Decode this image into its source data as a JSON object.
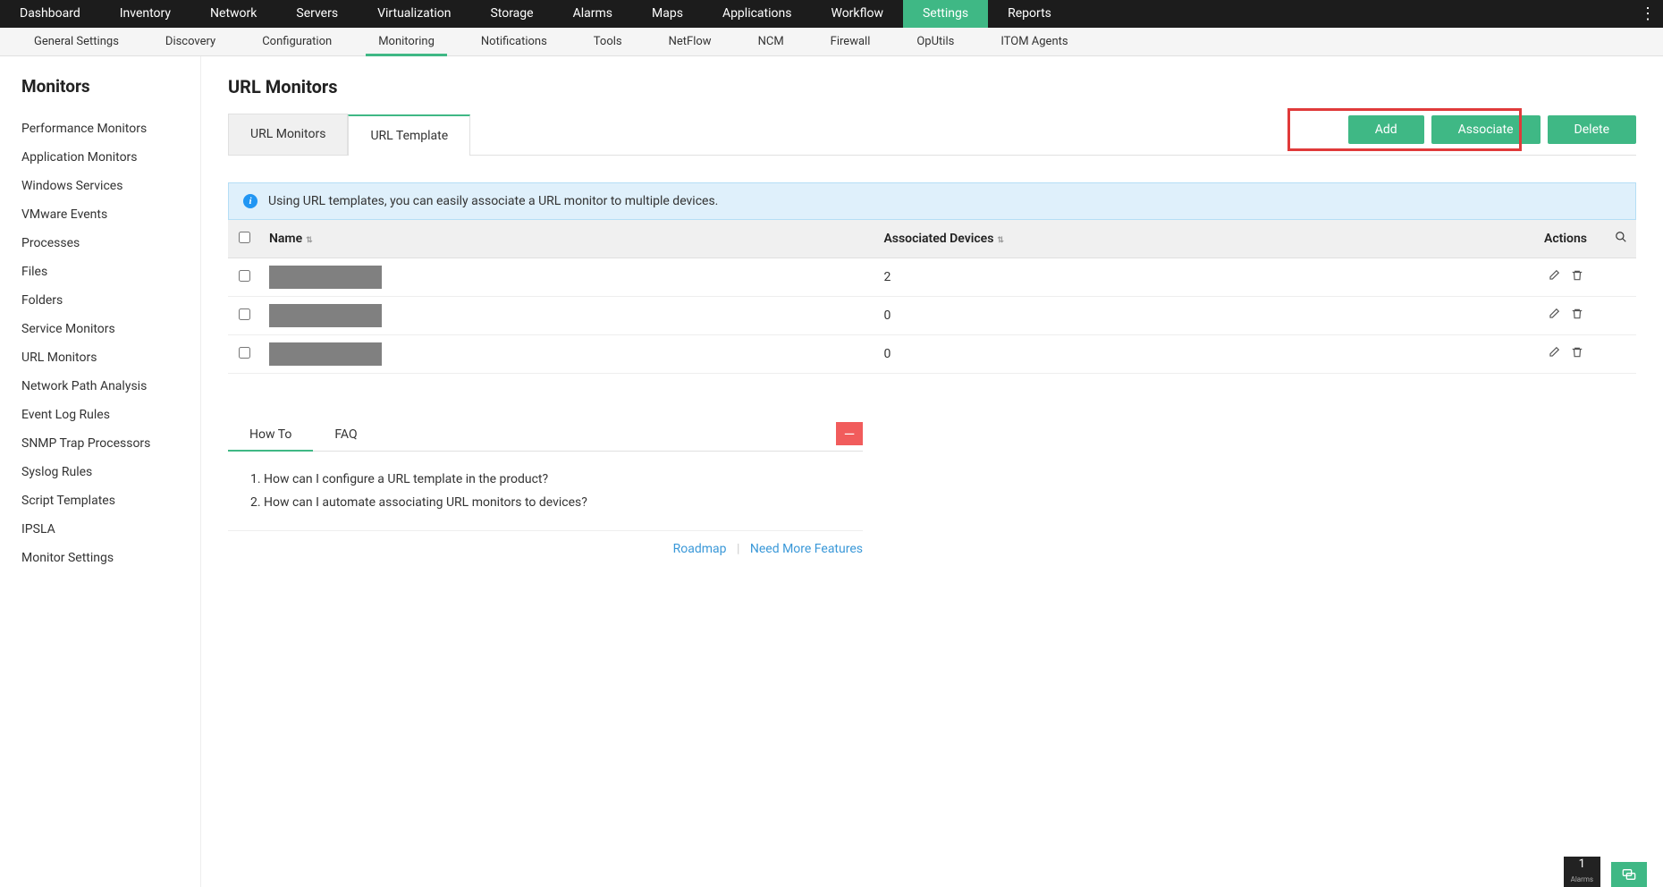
{
  "topnav": {
    "items": [
      "Dashboard",
      "Inventory",
      "Network",
      "Servers",
      "Virtualization",
      "Storage",
      "Alarms",
      "Maps",
      "Applications",
      "Workflow",
      "Settings",
      "Reports"
    ],
    "active": "Settings"
  },
  "subnav": {
    "items": [
      "General Settings",
      "Discovery",
      "Configuration",
      "Monitoring",
      "Notifications",
      "Tools",
      "NetFlow",
      "NCM",
      "Firewall",
      "OpUtils",
      "ITOM Agents"
    ],
    "active": "Monitoring"
  },
  "sidebar": {
    "title": "Monitors",
    "items": [
      "Performance Monitors",
      "Application Monitors",
      "Windows Services",
      "VMware Events",
      "Processes",
      "Files",
      "Folders",
      "Service Monitors",
      "URL Monitors",
      "Network Path Analysis",
      "Event Log Rules",
      "SNMP Trap Processors",
      "Syslog Rules",
      "Script Templates",
      "IPSLA",
      "Monitor Settings"
    ]
  },
  "page": {
    "title": "URL Monitors",
    "tabs": [
      "URL Monitors",
      "URL Template"
    ],
    "activeTab": "URL Template",
    "buttons": {
      "add": "Add",
      "associate": "Associate",
      "delete": "Delete"
    },
    "info": "Using URL templates, you can easily associate a URL monitor to multiple devices."
  },
  "table": {
    "columns": {
      "name": "Name",
      "devices": "Associated Devices",
      "actions": "Actions"
    },
    "rows": [
      {
        "name": "",
        "devices": "2"
      },
      {
        "name": "",
        "devices": "0"
      },
      {
        "name": "",
        "devices": "0"
      }
    ]
  },
  "howto": {
    "tabs": [
      "How To",
      "FAQ"
    ],
    "activeTab": "How To",
    "items": [
      "How can I configure a URL template in the product?",
      "How can I automate associating URL monitors to devices?"
    ],
    "footer": {
      "roadmap": "Roadmap",
      "need": "Need More Features"
    }
  },
  "widgets": {
    "alarms_count": "1",
    "alarms_label": "Alarms"
  }
}
